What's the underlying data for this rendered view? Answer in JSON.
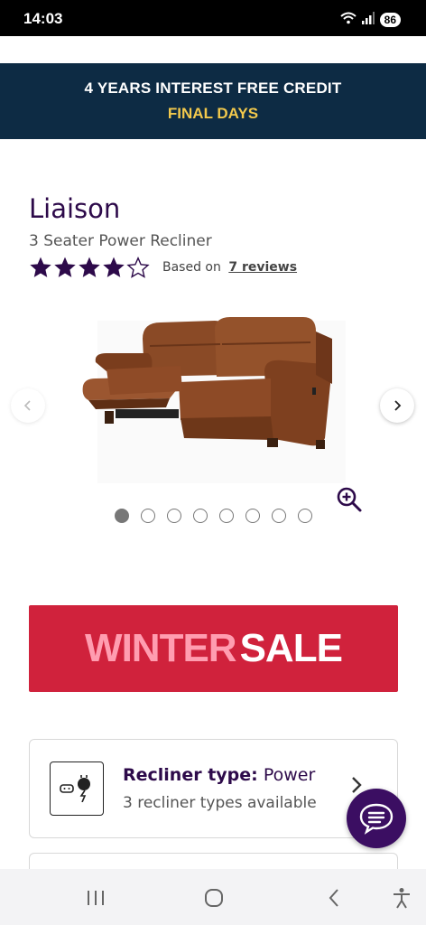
{
  "status_bar": {
    "time": "14:03",
    "battery": "86",
    "icons": [
      "wifi-icon",
      "signal-icon",
      "battery-icon"
    ]
  },
  "promo": {
    "line1": "4 YEARS INTEREST FREE CREDIT",
    "line2": "FINAL DAYS",
    "background_color": "#0d2b44",
    "highlight_color": "#f2c94c"
  },
  "product": {
    "title": "Liaison",
    "subtitle": "3 Seater Power Recliner",
    "rating": 4,
    "rating_max": 5,
    "rating_prefix": "Based on",
    "reviews_link": "7 reviews"
  },
  "gallery": {
    "image_count": 8,
    "active_index": 0,
    "prev_icon": "chevron-left-icon",
    "next_icon": "chevron-right-icon",
    "zoom_icon": "zoom-in-icon"
  },
  "sale_banner": {
    "word1": "WINTER",
    "word2": "SALE",
    "background_color": "#d0223c"
  },
  "feature": {
    "title_label": "Recliner type:",
    "title_value": "Power",
    "subtitle": "3 recliner types available",
    "icon": "power-plug-icon"
  },
  "chat": {
    "icon": "chat-icon"
  },
  "android_nav": {
    "icons": [
      "recents-icon",
      "home-icon",
      "back-icon",
      "accessibility-icon"
    ]
  },
  "colors": {
    "brand_purple": "#2d0a4a",
    "chat_purple": "#3b0e62"
  }
}
